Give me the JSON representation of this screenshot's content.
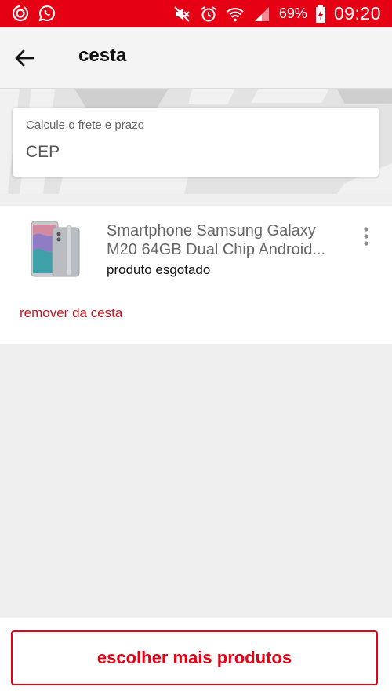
{
  "status_bar": {
    "battery": "69%",
    "time": "09:20",
    "color": "#e60014"
  },
  "header": {
    "title": "cesta",
    "back_icon": "arrow-left-icon"
  },
  "shipping": {
    "label": "Calcule o frete e prazo",
    "cep_placeholder": "CEP"
  },
  "product": {
    "name_line1": "Smartphone Samsung Galaxy",
    "name_line2": "M20 64GB Dual Chip Android...",
    "status": "produto esgotado",
    "remove_label": "remover da cesta",
    "more_icon": "more-vertical-icon"
  },
  "footer": {
    "cta_label": "escolher mais produtos",
    "accent": "#e60014"
  }
}
